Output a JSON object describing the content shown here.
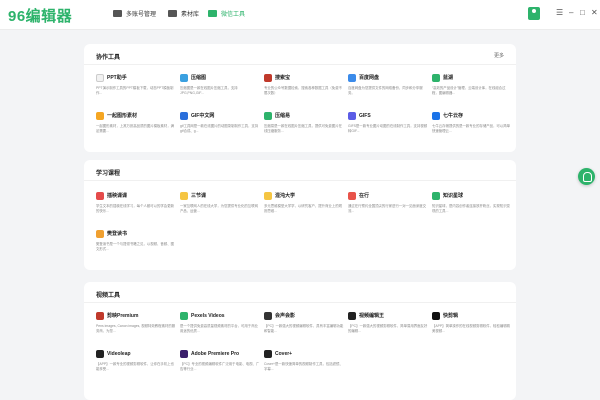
{
  "app": {
    "logo": "96编辑器"
  },
  "nav": [
    {
      "label": "多账号管理",
      "active": false
    },
    {
      "label": "素材库",
      "active": false
    },
    {
      "label": "微信工具",
      "active": true
    }
  ],
  "window_controls": {
    "collapse": "☰",
    "minimize": "–",
    "maximize": "□",
    "close": "✕"
  },
  "sections": {
    "collab": {
      "title": "协作工具",
      "more": "更多",
      "items": [
        {
          "name": "PPT助手",
          "icon_color": "#f2f2f2",
          "desc": "PPT演示制作工具的PPT模板下载，动态PPT模板制作..."
        },
        {
          "name": "压缩图",
          "icon_color": "#3aa0e0",
          "desc": "压缩图是一款在线图片压缩工具，支持JPG,PNG,GIF..."
        },
        {
          "name": "搜索宝",
          "icon_color": "#c0392b",
          "desc": "专业的公众号数据检索，搜索各种数据工具（免费不限次数）"
        },
        {
          "name": "百度网盘",
          "icon_color": "#3b8bea",
          "desc": "百度网盘为您提供文件的网络备份、同步和分享服务。"
        },
        {
          "name": "蓝湖",
          "icon_color": "#2db36b",
          "desc": "“高效的产品设计”管理，云端设计库，在线组合过程，图编辑器..."
        },
        {
          "name": "一起图形素材",
          "icon_color": "#f5a623",
          "desc": "一起图形素材，上其万张高品质的图片模板素材，满足需要..."
        },
        {
          "name": "GIF中文网",
          "icon_color": "#2a6fdb",
          "desc": "gif工具网是一款在线图片的动图录制制作工具，支持gif合成、g..."
        },
        {
          "name": "压缩易",
          "icon_color": "#2db36b",
          "desc": "压缩易是一款在线图片压缩工具，提供可免费图片在线压缩服务..."
        },
        {
          "name": "GIFS",
          "icon_color": "#5b5ce6",
          "desc": "GIFS是一款专业图片动图的在线制作工具，支持视频转GIF..."
        },
        {
          "name": "七牛云存",
          "icon_color": "#1a73e8",
          "desc": "七牛云存储提供的是一款专业的存储产品，可以简单快速管理云..."
        }
      ]
    },
    "study": {
      "title": "学习课程",
      "items": [
        {
          "name": "插秧课课",
          "icon_color": "#e54b4b",
          "desc": "学生文本的插秧在线学习，每个人都可以的学会更新的快乐..."
        },
        {
          "name": "三节课",
          "icon_color": "#f5c542",
          "desc": "一家互联网人的在线大学，为您提供专业化的互联网产品、运营..."
        },
        {
          "name": "混沌大学",
          "icon_color": "#f5c542",
          "desc": "多元思维模型大学学，以研究客户、提升商业上的规则思维..."
        },
        {
          "name": "在行",
          "icon_color": "#e8534a",
          "desc": "通过在行预约全国顶尖的行家进行一对一见面深度交流..."
        },
        {
          "name": "知识星球",
          "icon_color": "#2db36b",
          "desc": "知识星球，是内容创作者连接铁杆粉丝，实现知识变现的工具..."
        },
        {
          "name": "樊登读书",
          "icon_color": "#f0a030",
          "desc": "樊登读书是一个与提领书籍之见，以视频、音频、图文形式..."
        }
      ]
    },
    "video": {
      "title": "视频工具",
      "items": [
        {
          "name": "剪映Premium",
          "icon_color": "#c0392b",
          "desc": "Pens images, Canon images, 视频特效教程素材的服务商，为您..."
        },
        {
          "name": "Pexels Videos",
          "icon_color": "#2db36b",
          "desc": "是一个提供免费高质量视频素材的平台，可用于商业用途的优质..."
        },
        {
          "name": "会声会影",
          "icon_color": "#333",
          "desc": "【PC】一款强大的视频编辑软件，具有丰富编辑功能和智能..."
        },
        {
          "name": "视频编辑王",
          "icon_color": "#222",
          "desc": "【PC】一款强大的视频剪辑软件，简单易用界面友好的编辑..."
        },
        {
          "name": "快剪辑",
          "icon_color": "#111",
          "desc": "【APP】简单操作的在线视频剪辑软件，轻松编辑精美视频..."
        },
        {
          "name": "Videoleap",
          "icon_color": "#222",
          "desc": "【APP】一款专业的视频剪辑软件，让你在手机上也能享受..."
        },
        {
          "name": "Adobe Premiere Pro",
          "icon_color": "#3a1f6b",
          "desc": "【PC】专业的视频编辑软件广泛用于电影、电视、广告等行业..."
        },
        {
          "name": "Cover+",
          "icon_color": "#222",
          "desc": "Cover+是一款快速简单的视频制作工具，包括滤镜、字幕..."
        }
      ]
    }
  }
}
